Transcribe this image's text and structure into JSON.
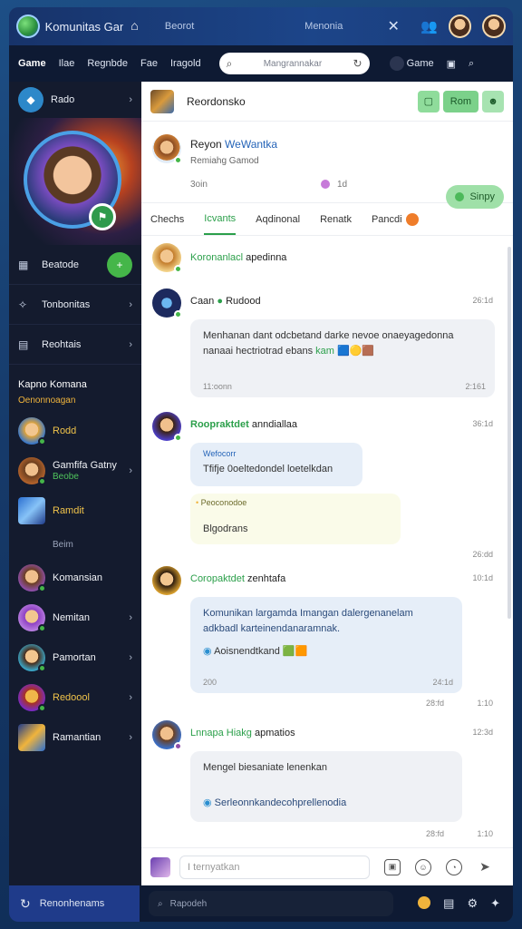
{
  "titlebar": {
    "app_title": "Komunitas Game",
    "seg_a": "Beorot",
    "seg_b": "Menonia"
  },
  "nav": {
    "items": [
      "Game",
      "Ilae",
      "Regnbde",
      "Fae",
      "Iragold"
    ],
    "search_placeholder": "Mangrannakar",
    "right_label": "Game"
  },
  "sidebar": {
    "head_label": "Rado",
    "items": [
      {
        "label": "Beatode"
      },
      {
        "label": "Tonbonitas"
      },
      {
        "label": "Reohtais"
      }
    ],
    "section_title": "Kapno Komana",
    "section_sub": "Oenonnoagan",
    "friends": [
      {
        "name": "Rodd",
        "sub": "",
        "gold": true
      },
      {
        "name": "Gamfifa Gatny",
        "sub": "Beobe",
        "gold": false
      },
      {
        "name": "Ramdit",
        "sub": "",
        "gold": true
      }
    ],
    "plain_label": "Beim",
    "friends2": [
      {
        "name": "Komansian"
      },
      {
        "name": "Nemitan"
      },
      {
        "name": "Pamortan"
      },
      {
        "name": "Redoool",
        "gold": true
      },
      {
        "name": "Ramantian"
      }
    ]
  },
  "main": {
    "header_title": "Reordonsko",
    "header_btn": "Rom",
    "profile": {
      "name_a": "Reyon",
      "name_b": "WeWantka",
      "sub": "Remiahg Gamod",
      "meta_a": "3oin",
      "meta_b": "1d",
      "pill": "Sinpy"
    },
    "tabs": [
      "Chechs",
      "Icvants",
      "Aqdinonal",
      "Renatk",
      "Pancdi"
    ],
    "posts": [
      {
        "title_a": "Koronanlacl",
        "title_b": "apedinna"
      },
      {
        "title_a": "Caan",
        "title_b": "Rudood",
        "time": "26:1d",
        "text": "Menhanan dant odcbetand darke nevoe onaeyagedonna nanaai hectriotrad ebans",
        "text_hl": "kam",
        "meta_a": "11:oonn",
        "meta_b": "2:161"
      },
      {
        "title_a": "Roopraktdet",
        "title_b": "anndiallaa",
        "time": "36:1d",
        "quote_label": "Wefocorr",
        "quote_text": "Tfifje 0oeltedondel loetelkdan",
        "yellow_label": "Peoconodoe",
        "yellow_text": "Blgodrans",
        "meta_b": "26:dd"
      },
      {
        "title_a": "Coropaktdet",
        "title_b": "zenhtafa",
        "time": "10:1d",
        "text": "Komunikan largamda Imangan dalergenanelam adkbadl karteinendanaramnak.",
        "link": "Aoisnendtkand",
        "meta_a": "200",
        "meta_b": "24:1d",
        "foot_a": "28:fd",
        "foot_b": "1:10"
      },
      {
        "title_a": "Lnnapa Hiakg",
        "title_b": "apmatios",
        "time": "12:3d",
        "text": "Mengel biesaniate lenenkan",
        "link": "Serleonnkandecohprellenodia",
        "foot_a": "28:fd",
        "foot_b": "1:10"
      }
    ],
    "composer_placeholder": "I ternyatkan"
  },
  "bottombar": {
    "left_label": "Renonhenams",
    "search_placeholder": "Rapodeh"
  },
  "colors": {
    "accent_green": "#2b9f4a",
    "link_blue": "#2564b8",
    "sidebar_bg": "#141b2e"
  }
}
